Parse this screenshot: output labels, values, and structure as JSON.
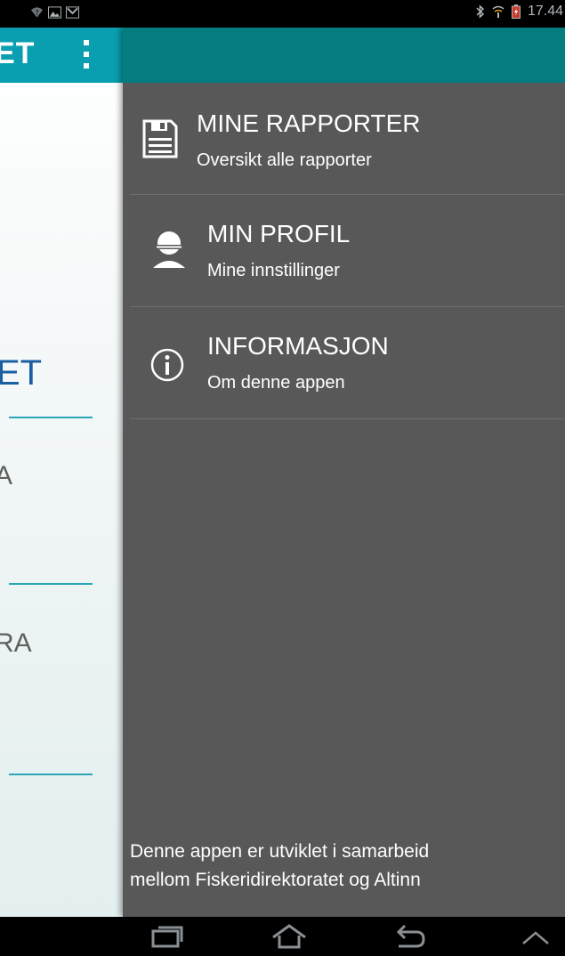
{
  "status_bar": {
    "time": "17.44",
    "left_icons": [
      "wifi-question-icon",
      "image-notification-icon",
      "gmail-icon"
    ],
    "right_icons": [
      "bluetooth-icon",
      "signal-icon",
      "battery-charging-icon"
    ]
  },
  "background_screen": {
    "title_fragment": "ET",
    "heading_fragment": "ET",
    "label_1_fragment": "A",
    "label_2_fragment": "RA",
    "overflow_icon": "overflow-menu-icon"
  },
  "drawer": {
    "header_color": "#047d81",
    "items": [
      {
        "icon": "floppy-disk-icon",
        "title": "MINE RAPPORTER",
        "subtitle": "Oversikt alle rapporter"
      },
      {
        "icon": "person-icon",
        "title": "MIN PROFIL",
        "subtitle": "Mine innstillinger"
      },
      {
        "icon": "info-icon",
        "title": "INFORMASJON",
        "subtitle": "Om denne appen"
      }
    ],
    "footer": {
      "line1": "Denne appen er utviklet i samarbeid",
      "line2": "mellom Fiskeridirektoratet og Altinn"
    }
  },
  "nav_bar": {
    "buttons": [
      "recent-apps-icon",
      "home-icon",
      "back-icon",
      "collapse-up-icon"
    ]
  },
  "colors": {
    "drawer_bg": "#585858",
    "drawer_header": "#047d81",
    "app_action_bar": "#0a9fb0",
    "app_heading": "#1a5fa0",
    "app_divider": "#2aa6b6"
  }
}
